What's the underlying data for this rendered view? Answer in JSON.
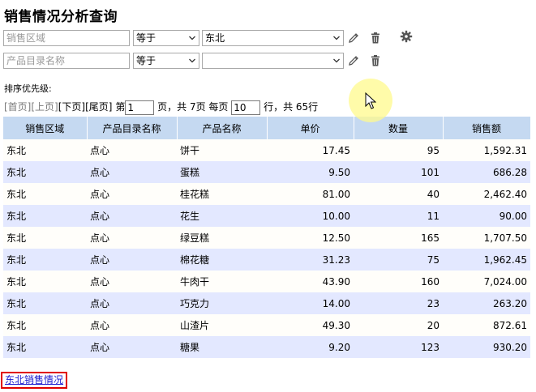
{
  "page": {
    "title": "销售情况分析查询"
  },
  "filters": [
    {
      "field_placeholder": "销售区域",
      "operator": "等于",
      "value": "东北"
    },
    {
      "field_placeholder": "产品目录名称",
      "operator": "等于",
      "value": ""
    }
  ],
  "sort_label": "排序优先级:",
  "pager": {
    "first": "[首页]",
    "prev": "[上页]",
    "next": "[下页]",
    "last": "[尾页]",
    "page_prefix": "第",
    "page_value": "1",
    "page_suffix": "页，共 7页 每页",
    "per_page_value": "10",
    "rows_suffix": "行，共 65行"
  },
  "table": {
    "columns": [
      "销售区域",
      "产品目录名称",
      "产品名称",
      "单价",
      "数量",
      "销售额"
    ],
    "rows": [
      [
        "东北",
        "点心",
        "饼干",
        "17.45",
        "95",
        "1,592.31"
      ],
      [
        "东北",
        "点心",
        "蛋糕",
        "9.50",
        "101",
        "686.28"
      ],
      [
        "东北",
        "点心",
        "桂花糕",
        "81.00",
        "40",
        "2,462.40"
      ],
      [
        "东北",
        "点心",
        "花生",
        "10.00",
        "11",
        "90.00"
      ],
      [
        "东北",
        "点心",
        "绿豆糕",
        "12.50",
        "165",
        "1,707.50"
      ],
      [
        "东北",
        "点心",
        "棉花糖",
        "31.23",
        "75",
        "1,962.45"
      ],
      [
        "东北",
        "点心",
        "牛肉干",
        "43.90",
        "160",
        "7,024.00"
      ],
      [
        "东北",
        "点心",
        "巧克力",
        "14.00",
        "23",
        "263.20"
      ],
      [
        "东北",
        "点心",
        "山渣片",
        "49.30",
        "20",
        "872.61"
      ],
      [
        "东北",
        "点心",
        "糖果",
        "9.20",
        "123",
        "930.20"
      ]
    ]
  },
  "footer_link": "东北销售情况"
}
